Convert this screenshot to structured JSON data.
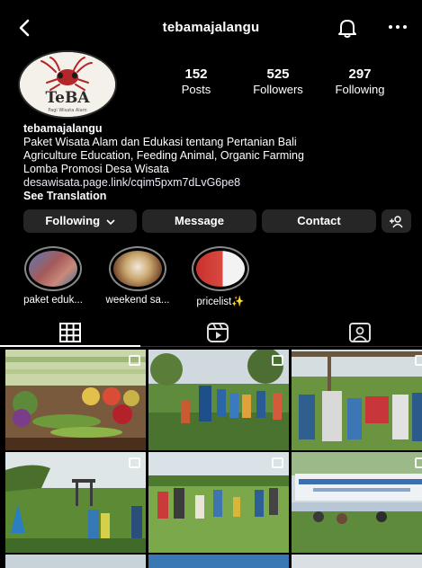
{
  "header": {
    "username": "tebamajalangu"
  },
  "profile": {
    "logo_text": "TeBA",
    "logo_tagline": "Pagi Wisata Alam",
    "stats": [
      {
        "value": "152",
        "label": "Posts"
      },
      {
        "value": "525",
        "label": "Followers"
      },
      {
        "value": "297",
        "label": "Following"
      }
    ]
  },
  "bio": {
    "name": "tebamajalangu",
    "lines": [
      "Paket Wisata Alam dan Edukasi tentang Pertanian Bali",
      "Agriculture Education, Feeding Animal, Organic Farming",
      "Lomba Promosi Desa Wisata"
    ],
    "link": "desawisata.page.link/cqim5pxm7dLvG6pe8",
    "translate": "See Translation"
  },
  "buttons": {
    "following": "Following",
    "message": "Message",
    "contact": "Contact"
  },
  "highlights": [
    {
      "label": "paket eduk..."
    },
    {
      "label": "weekend sa..."
    },
    {
      "label": "pricelist✨"
    }
  ],
  "tabs": [
    "grid-icon",
    "reels-icon",
    "tagged-icon"
  ],
  "colors": {
    "background": "#000000",
    "button": "#262626",
    "text": "#ffffff"
  }
}
